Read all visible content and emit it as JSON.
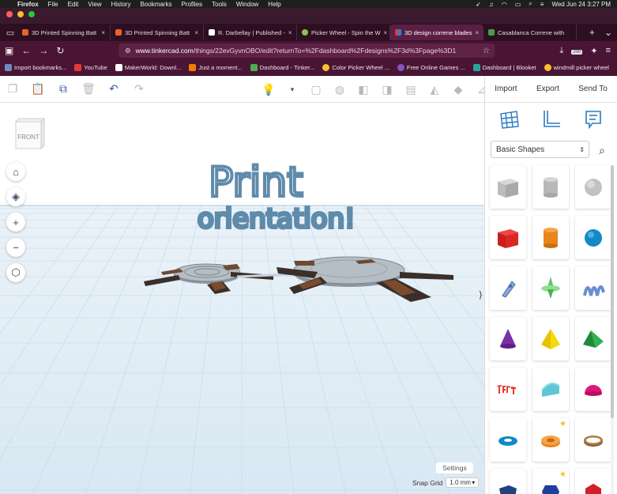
{
  "menubar": {
    "app": "Firefox",
    "items": [
      "File",
      "Edit",
      "View",
      "History",
      "Bookmarks",
      "Profiles",
      "Tools",
      "Window",
      "Help"
    ],
    "datetime": "Wed Jun 24  3:27 PM"
  },
  "tabs": [
    {
      "label": "3D Printed Spinning Batt",
      "color": "#e8632a",
      "active": false
    },
    {
      "label": "3D Printed Spinning Batt",
      "color": "#e8632a",
      "active": false
    },
    {
      "label": "R. Darbellay | Published -",
      "color": "#ffffff",
      "active": false
    },
    {
      "label": "Picker Wheel - Spin the W",
      "color": "#8bc34a",
      "active": false
    },
    {
      "label": "3D design correne blades",
      "color": "#e53935",
      "active": true
    },
    {
      "label": "Casablanca Correne with",
      "color": "#43a047",
      "active": false
    }
  ],
  "address": {
    "host": "www.tinkercad.com",
    "path": "/things/22evGyvnOBO/edit?returnTo=%2Fdashboard%2Fdesigns%2F3d%3Fpage%3D1"
  },
  "extension_badge": "200",
  "bookmarks": [
    {
      "label": "Import bookmarks...",
      "color": "#6c8ebf"
    },
    {
      "label": "YouTube",
      "color": "#e53935"
    },
    {
      "label": "MakerWorld: Downl...",
      "color": "#ffffff"
    },
    {
      "label": "Just a moment...",
      "color": "#f57c00"
    },
    {
      "label": "Dashboard - Tinker...",
      "color": "#4caf50"
    },
    {
      "label": "Color Picker Wheel ...",
      "color": "#fbc02d"
    },
    {
      "label": "Free Online Games ...",
      "color": "#7e57c2"
    },
    {
      "label": "Dashboard | Blooket",
      "color": "#26a69a"
    },
    {
      "label": "windmill picker wheel",
      "color": "#fbc02d"
    }
  ],
  "panel": {
    "import": "Import",
    "export": "Export",
    "send_to": "Send To",
    "shape_category": "Basic Shapes"
  },
  "viewcube_label": "FRONT",
  "scene_text": {
    "line1": "Print",
    "line2": "orientation!"
  },
  "settings_label": "Settings",
  "snap_grid": {
    "label": "Snap Grid",
    "value": "1.0 mm"
  },
  "colors": {
    "accent": "#3b5ea8",
    "scene_text": "#5f8bab",
    "blade_dark": "#3a2f2a",
    "blade_brown": "#7a4b2e",
    "base_gray": "#9aa3ad"
  }
}
